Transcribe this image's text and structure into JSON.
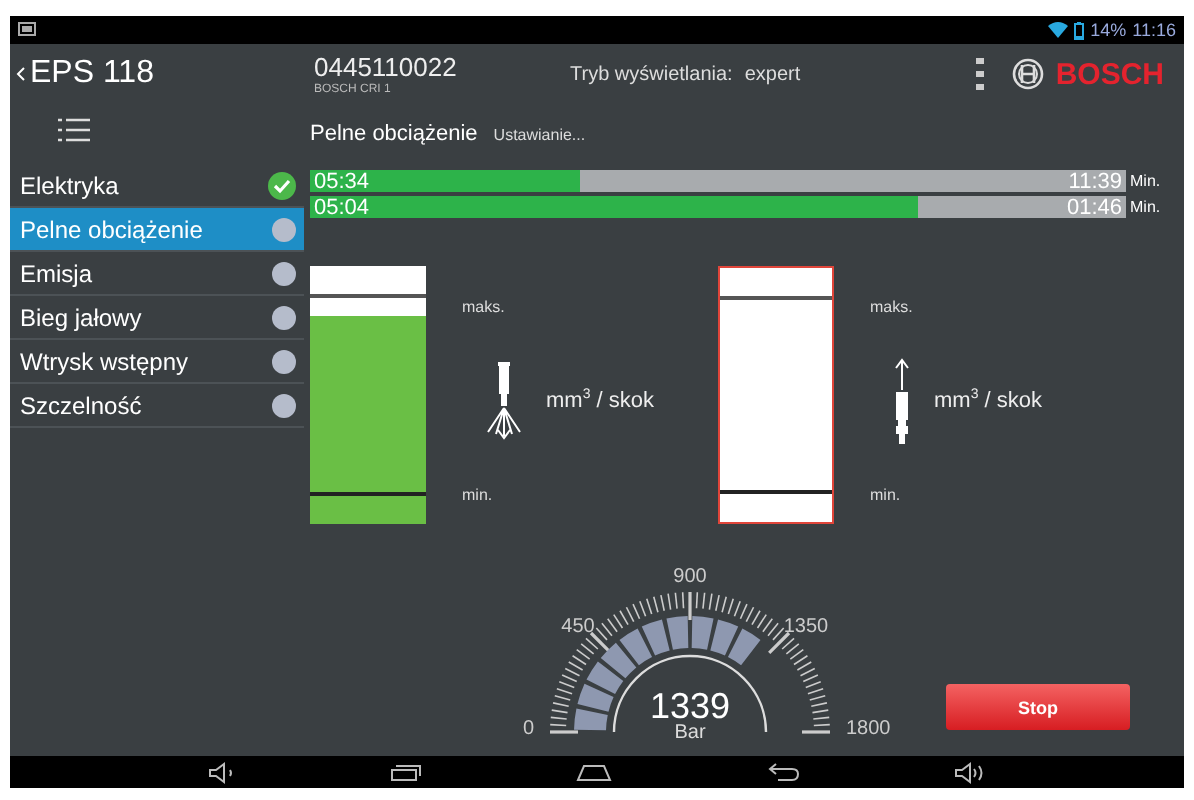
{
  "status_bar": {
    "battery": "14%",
    "time": "11:16"
  },
  "header": {
    "back_label": "EPS 118",
    "part_number": "0445110022",
    "part_subtitle": "BOSCH CRI 1",
    "mode_label": "Tryb wyświetlania:",
    "mode_value": "expert",
    "brand": "BOSCH"
  },
  "subheader": {
    "title": "Pelne obciążenie",
    "status": "Ustawianie..."
  },
  "sidebar": {
    "items": [
      {
        "label": "Elektryka",
        "done": true,
        "selected": false
      },
      {
        "label": "Pelne obciążenie",
        "done": false,
        "selected": true
      },
      {
        "label": "Emisja",
        "done": false,
        "selected": false
      },
      {
        "label": "Bieg jałowy",
        "done": false,
        "selected": false
      },
      {
        "label": "Wtrysk wstępny",
        "done": false,
        "selected": false
      },
      {
        "label": "Szczelność",
        "done": false,
        "selected": false
      }
    ]
  },
  "progress": [
    {
      "elapsed": "05:34",
      "remaining": "11:39",
      "unit": "Min.",
      "level": 0.33
    },
    {
      "elapsed": "05:04",
      "remaining": "01:46",
      "unit": "Min.",
      "level": 0.745
    }
  ],
  "measurements": [
    {
      "kind": "injection",
      "level": 0.81,
      "alarm": false,
      "max_label": "maks.",
      "min_label": "min.",
      "unit": "mm$^{3}$ / skok"
    },
    {
      "kind": "return",
      "alarm": true,
      "max_label": "maks.",
      "min_label": "min.",
      "unit": "mm$^{3}$ / skok"
    }
  ],
  "pressure_gauge": {
    "value": "1339",
    "unit": "Bar",
    "scale_labels": [
      "0",
      "450",
      "900",
      "1350",
      "1800"
    ]
  },
  "stop_button": "Stop"
}
